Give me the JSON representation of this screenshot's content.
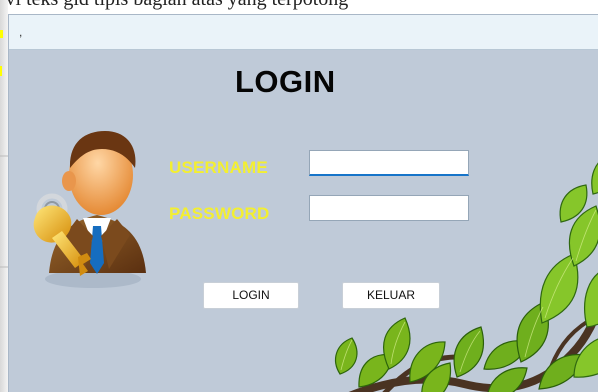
{
  "app": {
    "cut_text": "jvl teks gid tipis bagian atas yang terpotong",
    "title_mark": ","
  },
  "login": {
    "title": "LOGIN",
    "username_label": "USERNAME",
    "password_label": "PASSWORD",
    "username_value": "",
    "password_value": ""
  },
  "buttons": {
    "login_label": "LOGIN",
    "keluar_label": "KELUAR"
  },
  "icons": {
    "avatar": "user-key-icon",
    "decoration": "leafy-branch-icon"
  },
  "colors": {
    "background": "#c0ccd9",
    "label": "#f3ef31",
    "title": "#050505",
    "input_focus": "#1674c9"
  }
}
